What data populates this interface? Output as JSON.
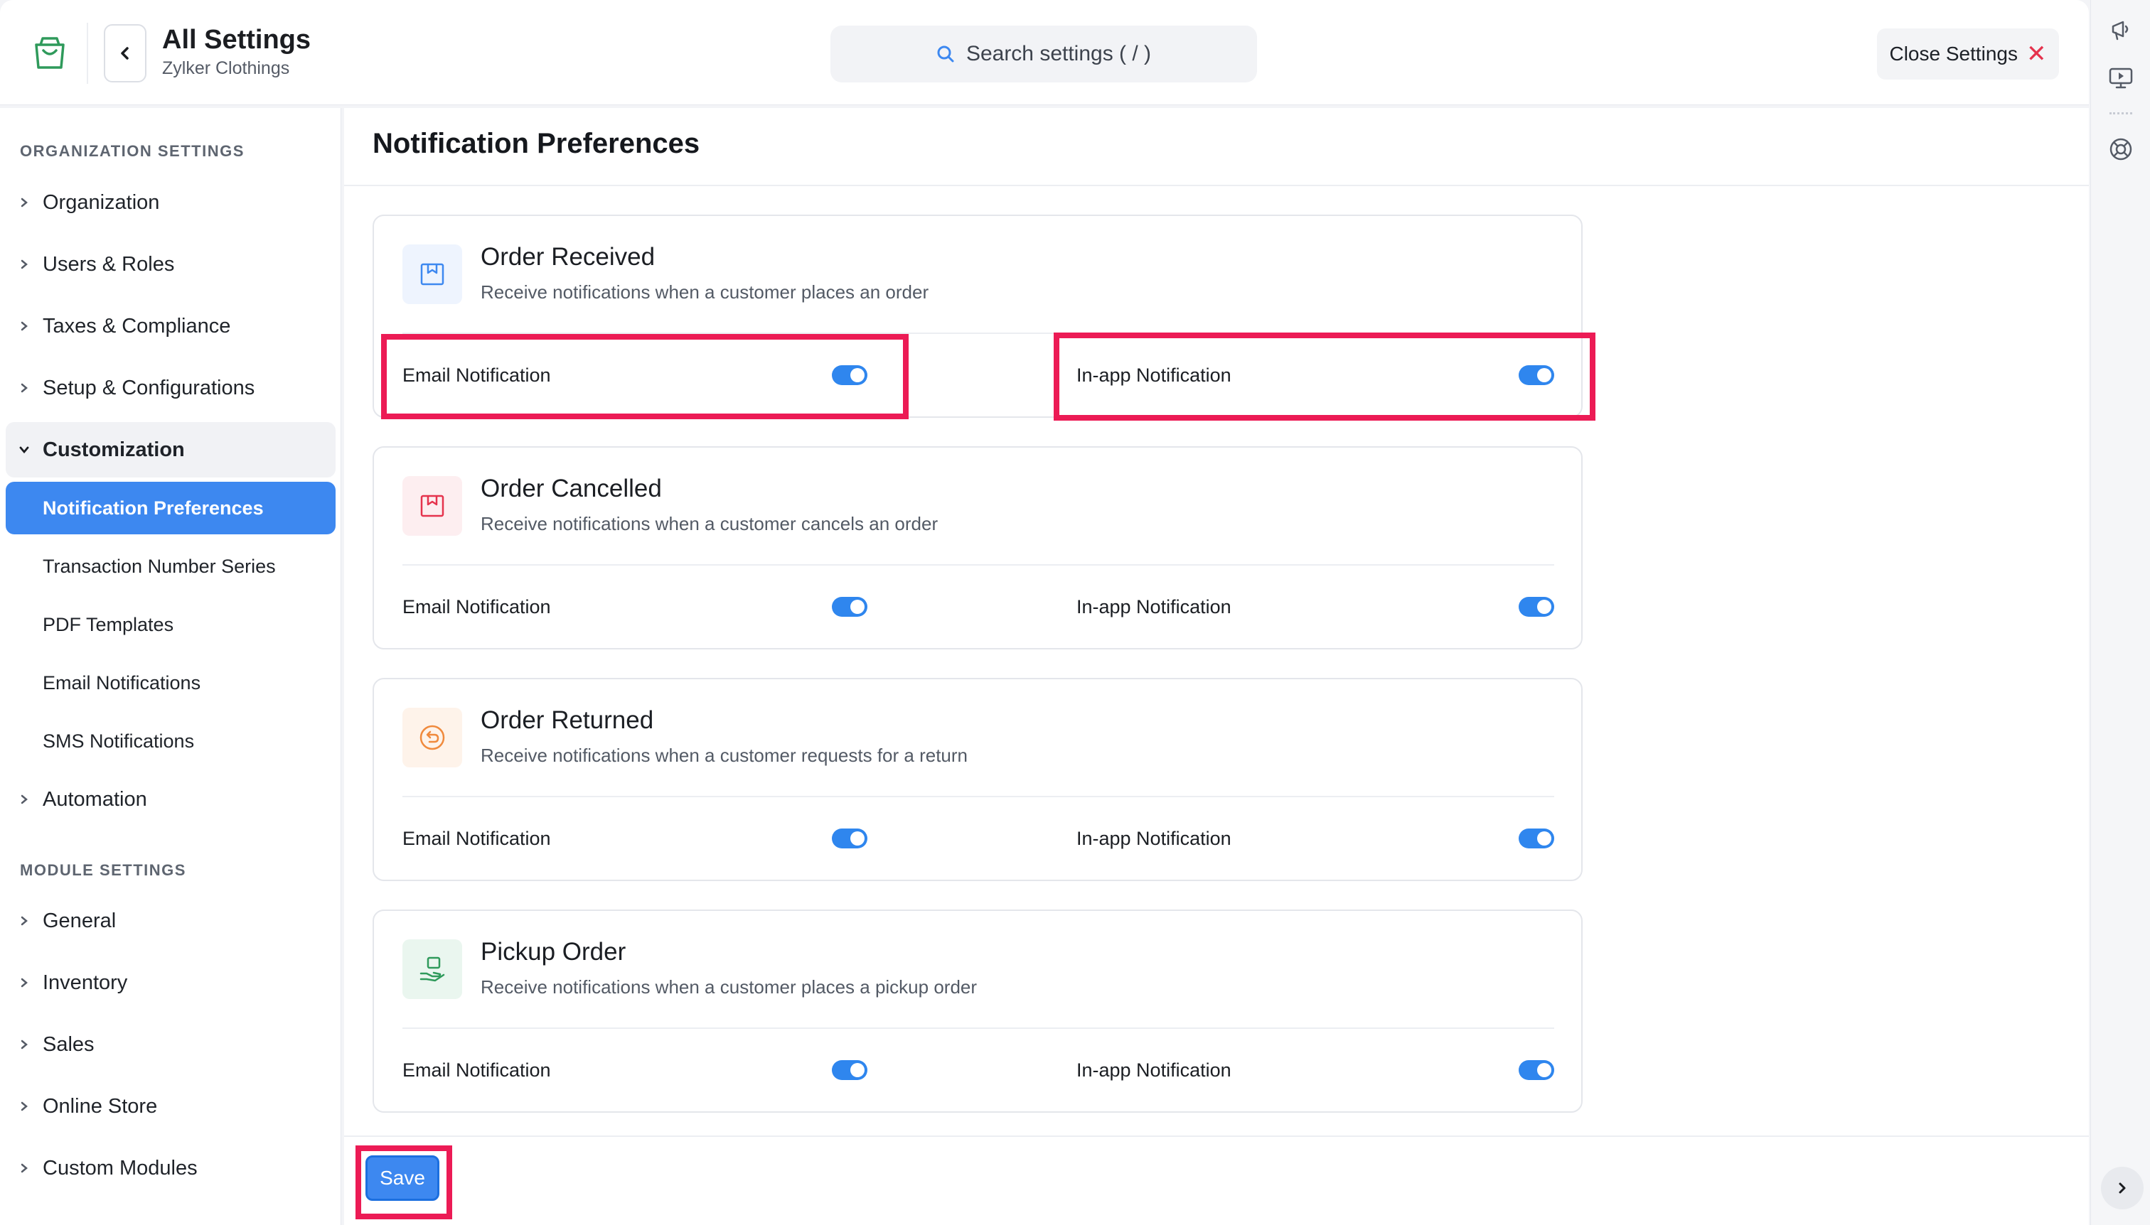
{
  "header": {
    "title": "All Settings",
    "org_name": "Zylker Clothings",
    "search_placeholder": "Search settings ( / )",
    "close_label": "Close Settings",
    "close_symbol": "✕"
  },
  "sidebar": {
    "org_section": "ORGANIZATION SETTINGS",
    "org_items": [
      {
        "label": "Organization"
      },
      {
        "label": "Users & Roles"
      },
      {
        "label": "Taxes & Compliance"
      },
      {
        "label": "Setup & Configurations"
      },
      {
        "label": "Customization"
      }
    ],
    "customization_sub": [
      {
        "label": "Notification Preferences",
        "active": true
      },
      {
        "label": "Transaction Number Series"
      },
      {
        "label": "PDF Templates"
      },
      {
        "label": "Email Notifications"
      },
      {
        "label": "SMS Notifications"
      }
    ],
    "automation": "Automation",
    "module_section": "MODULE SETTINGS",
    "module_items": [
      {
        "label": "General"
      },
      {
        "label": "Inventory"
      },
      {
        "label": "Sales"
      },
      {
        "label": "Online Store"
      },
      {
        "label": "Custom Modules"
      }
    ]
  },
  "main": {
    "page_title": "Notification Preferences",
    "cards": [
      {
        "title": "Order Received",
        "desc": "Receive notifications when a customer places an order",
        "email_label": "Email Notification",
        "inapp_label": "In-app Notification",
        "email_on": true,
        "inapp_on": true,
        "icon": "box-icon",
        "icon_color": "#3d88f0",
        "icon_bg": "#eef4fe"
      },
      {
        "title": "Order Cancelled",
        "desc": "Receive notifications when a customer cancels an order",
        "email_label": "Email Notification",
        "inapp_label": "In-app Notification",
        "email_on": true,
        "inapp_on": true,
        "icon": "box-cancel-icon",
        "icon_color": "#e5334d",
        "icon_bg": "#fdeef0"
      },
      {
        "title": "Order Returned",
        "desc": "Receive notifications when a customer requests for a return",
        "email_label": "Email Notification",
        "inapp_label": "In-app Notification",
        "email_on": true,
        "inapp_on": true,
        "icon": "return-icon",
        "icon_color": "#f08a3d",
        "icon_bg": "#fef3ea"
      },
      {
        "title": "Pickup Order",
        "desc": "Receive notifications when a customer places a pickup order",
        "email_label": "Email Notification",
        "inapp_label": "In-app Notification",
        "email_on": true,
        "inapp_on": true,
        "icon": "hand-package-icon",
        "icon_color": "#2f9a5b",
        "icon_bg": "#eaf6ef"
      }
    ],
    "save_label": "Save"
  },
  "colors": {
    "accent": "#3d88f0",
    "highlight": "#ec1b55",
    "brand_logo": "#2f9a5b"
  }
}
